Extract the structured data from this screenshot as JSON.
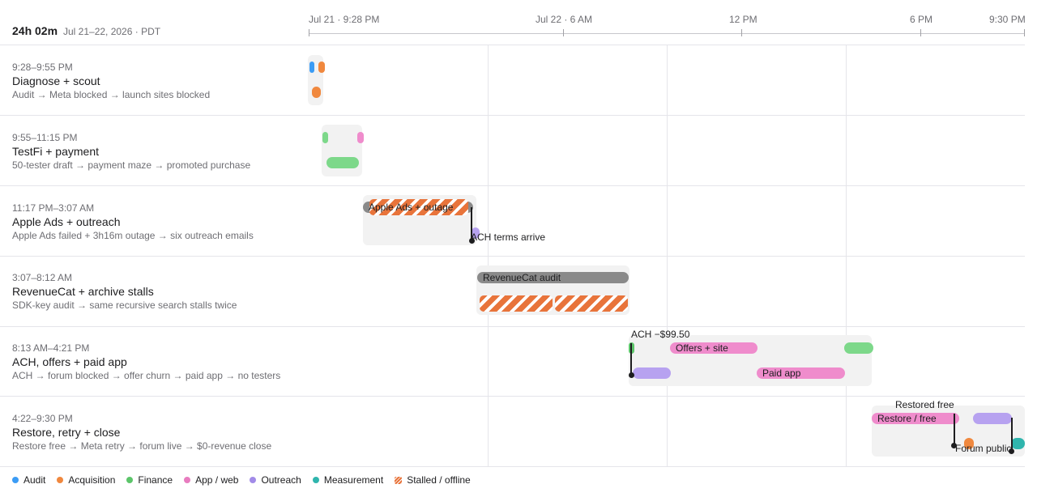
{
  "header": {
    "duration": "24h 02m",
    "range": "Jul 21–22, 2026 · PDT"
  },
  "axis": {
    "ticks": [
      "Jul 21 · 9:28 PM",
      "Jul 22 · 6 AM",
      "12 PM",
      "6 PM",
      "9:30 PM"
    ]
  },
  "rows": [
    {
      "time": "9:28–9:55 PM",
      "title": "Diagnose + scout",
      "subtitle": "Audit → Meta blocked → launch sites blocked"
    },
    {
      "time": "9:55–11:15 PM",
      "title": "TestFi + payment",
      "subtitle": "50-tester draft → payment maze → promoted purchase"
    },
    {
      "time": "11:17 PM–3:07 AM",
      "title": "Apple Ads + outreach",
      "subtitle": "Apple Ads failed + 3h16m outage → six outreach emails"
    },
    {
      "time": "3:07–8:12 AM",
      "title": "RevenueCat + archive stalls",
      "subtitle": "SDK-key audit → same recursive search stalls twice"
    },
    {
      "time": "8:13 AM–4:21 PM",
      "title": "ACH, offers + paid app",
      "subtitle": "ACH → forum blocked → offer churn → paid app → no testers"
    },
    {
      "time": "4:22–9:30 PM",
      "title": "Restore, retry + close",
      "subtitle": "Restore free → Meta retry → forum live → $0-revenue close"
    }
  ],
  "bars": {
    "apple_ads": "Apple Ads + outage",
    "revenuecat": "RevenueCat audit",
    "offers_site": "Offers + site",
    "paid_app": "Paid app",
    "restore_free": "Restore / free"
  },
  "annotations": {
    "ach_terms": "ACH terms arrive",
    "ach_amount": "ACH −$99.50",
    "restored_free": "Restored free",
    "forum_public": "Forum public"
  },
  "legend": [
    {
      "label": "Audit",
      "color": "#3b9cf5"
    },
    {
      "label": "Acquisition",
      "color": "#f0883e"
    },
    {
      "label": "Finance",
      "color": "#5cc56a"
    },
    {
      "label": "App / web",
      "color": "#e87cbf"
    },
    {
      "label": "Outreach",
      "color": "#a28be8"
    },
    {
      "label": "Measurement",
      "color": "#2fb5ad"
    },
    {
      "label": "Stalled / offline",
      "color": "#e8743b"
    }
  ],
  "colors": {
    "audit": "#3b9cf5",
    "acquisition": "#f0883e",
    "finance": "#7dd88a",
    "app_web": "#ef8ccc",
    "outreach": "#b7a2f0",
    "measurement": "#2fb5ad",
    "stalled": "#e8743b",
    "neutral_bar": "#8a8a8a"
  }
}
